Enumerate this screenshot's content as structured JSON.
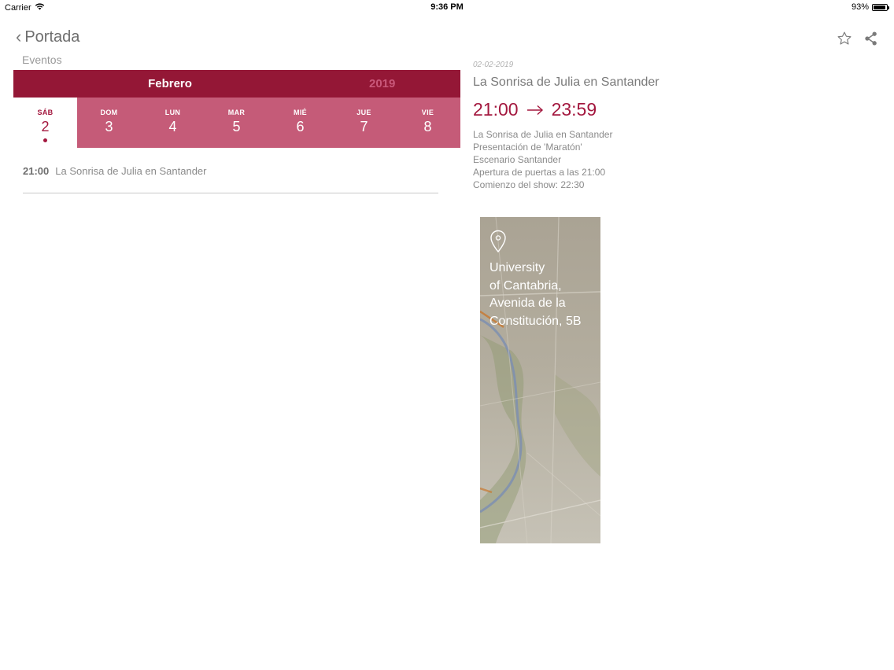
{
  "status_bar": {
    "carrier": "Carrier",
    "time": "9:36 PM",
    "battery": "93%",
    "battery_level": 0.93
  },
  "nav": {
    "back_label": "Portada",
    "section_title": "Eventos",
    "icons": [
      "star-icon",
      "share-icon"
    ]
  },
  "calendar": {
    "month": "Febrero",
    "year": "2019",
    "days": [
      {
        "name": "SÁB",
        "num": "2",
        "selected": true
      },
      {
        "name": "DOM",
        "num": "3"
      },
      {
        "name": "LUN",
        "num": "4"
      },
      {
        "name": "MAR",
        "num": "5"
      },
      {
        "name": "MIÉ",
        "num": "6"
      },
      {
        "name": "JUE",
        "num": "7"
      },
      {
        "name": "VIE",
        "num": "8"
      }
    ]
  },
  "events": [
    {
      "time": "21:00",
      "title": "La Sonrisa de Julia en Santander"
    }
  ],
  "detail": {
    "date": "02-02-2019",
    "title": "La Sonrisa de Julia en Santander",
    "start": "21:00",
    "end": "23:59",
    "description": [
      "La Sonrisa de Julia en Santander",
      "Presentación de 'Maratón'",
      "Escenario Santander",
      "Apertura de puertas a las 21:00",
      "Comienzo del show: 22:30"
    ]
  },
  "map": {
    "address_lines": [
      "University",
      "of Cantabria,",
      "Avenida de la",
      "Constitución, 5B"
    ]
  },
  "colors": {
    "accent": "#941736",
    "day_strip": "#c55b78",
    "time_text": "#a3173e"
  }
}
